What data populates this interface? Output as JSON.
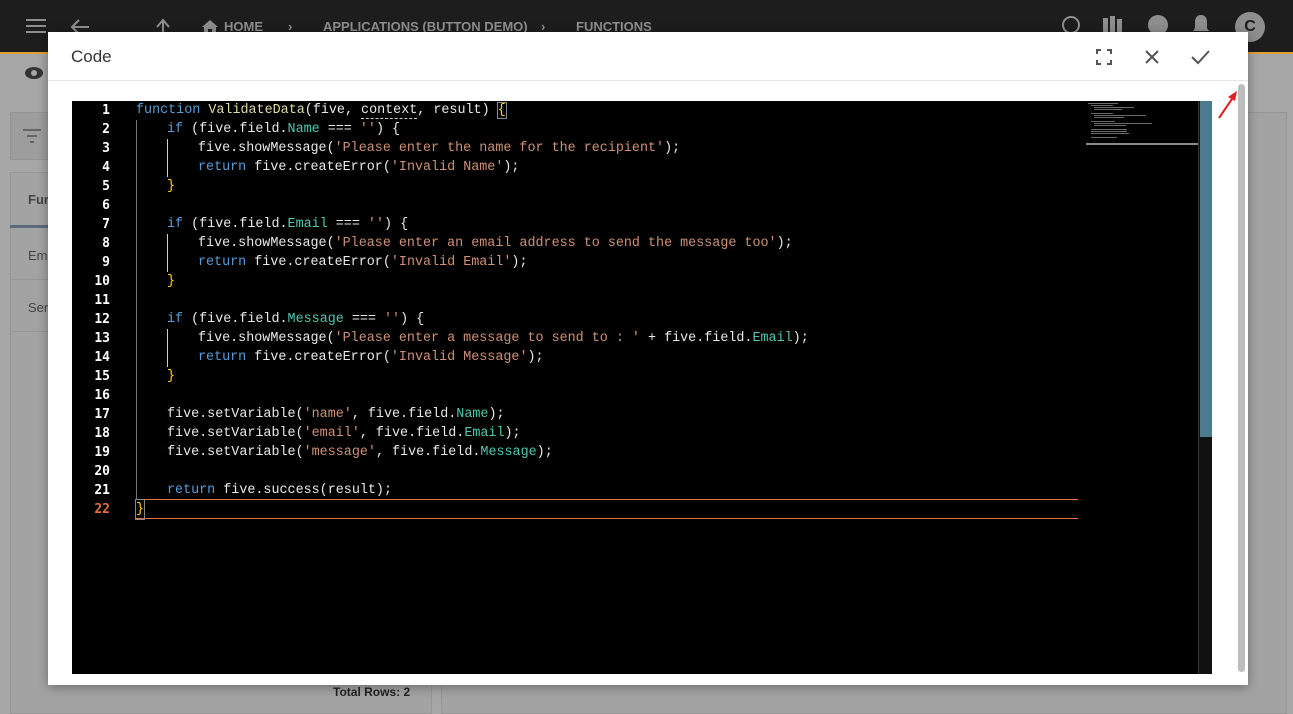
{
  "topbar": {
    "home_label": "HOME",
    "app_label": "APPLICATIONS (BUTTON DEMO)",
    "functions_label": "FUNCTIONS",
    "avatar_initial": "C"
  },
  "background": {
    "tab_label": "Fur",
    "row1": "Em",
    "row2": "Ser",
    "total_rows": "Total Rows: 2"
  },
  "dialog": {
    "title": "Code",
    "icons": {
      "fullscreen": "fullscreen-icon",
      "close": "close-icon",
      "confirm": "check-icon"
    }
  },
  "editor": {
    "line_numbers": [
      "1",
      "2",
      "3",
      "4",
      "5",
      "6",
      "7",
      "8",
      "9",
      "10",
      "11",
      "12",
      "13",
      "14",
      "15",
      "16",
      "17",
      "18",
      "19",
      "20",
      "21",
      "22"
    ],
    "current_line": "22",
    "colors": {
      "keyword": "#569cd6",
      "function": "#dcdcaa",
      "property": "#4ec9b0",
      "string": "#ce9178",
      "bracket": "#ffd700",
      "current_line": "#e46f40"
    },
    "code": {
      "l1": {
        "kw": "function",
        "fn": "ValidateData",
        "p1": "(five, ",
        "ctx": "context",
        "p2": ", result) ",
        "b": "{"
      },
      "l2": {
        "kw": "if",
        "a": " (five.field.",
        "pr": "Name",
        "b": " === ",
        "st": "''",
        "c": ") {"
      },
      "l3": {
        "a": "five.showMessage(",
        "st": "'Please enter the name for the recipient'",
        "b": ");"
      },
      "l4": {
        "kw": "return",
        "a": " five.createError(",
        "st": "'Invalid Name'",
        "b": ");"
      },
      "l5": {
        "b": "}"
      },
      "l7": {
        "kw": "if",
        "a": " (five.field.",
        "pr": "Email",
        "b": " === ",
        "st": "''",
        "c": ") {"
      },
      "l8": {
        "a": "five.showMessage(",
        "st": "'Please enter an email address to send the message too'",
        "b": ");"
      },
      "l9": {
        "kw": "return",
        "a": " five.createError(",
        "st": "'Invalid Email'",
        "b": ");"
      },
      "l10": {
        "b": "}"
      },
      "l12": {
        "kw": "if",
        "a": " (five.field.",
        "pr": "Message",
        "b": " === ",
        "st": "''",
        "c": ") {"
      },
      "l13": {
        "a": "five.showMessage(",
        "st": "'Please enter a message to send to : '",
        "b": " + five.field.",
        "pr": "Email",
        "c": ");"
      },
      "l14": {
        "kw": "return",
        "a": " five.createError(",
        "st": "'Invalid Message'",
        "b": ");"
      },
      "l15": {
        "b": "}"
      },
      "l17": {
        "a": "five.setVariable(",
        "st": "'name'",
        "b": ", five.field.",
        "pr": "Name",
        "c": ");"
      },
      "l18": {
        "a": "five.setVariable(",
        "st": "'email'",
        "b": ", five.field.",
        "pr": "Email",
        "c": ");"
      },
      "l19": {
        "a": "five.setVariable(",
        "st": "'message'",
        "b": ", five.field.",
        "pr": "Message",
        "c": ");"
      },
      "l21": {
        "kw": "return",
        "a": " five.success(result);"
      },
      "l22": {
        "b": "}"
      }
    }
  }
}
